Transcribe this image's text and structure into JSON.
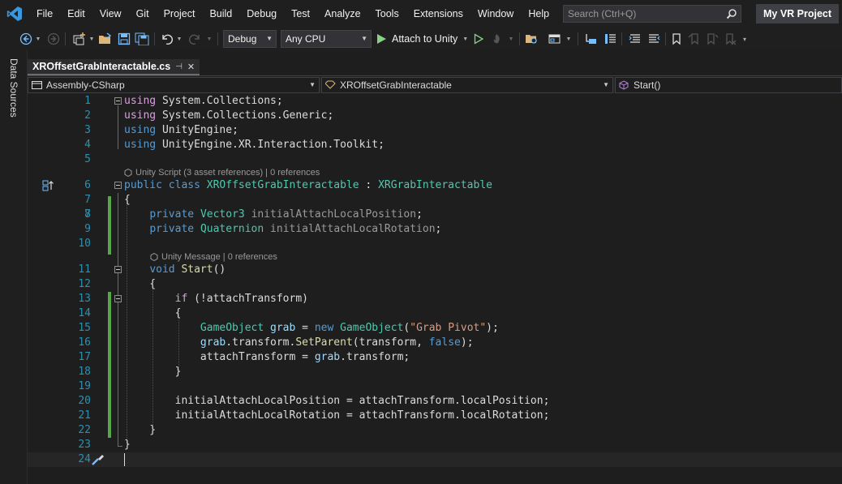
{
  "menubar": {
    "items": [
      "File",
      "Edit",
      "View",
      "Git",
      "Project",
      "Build",
      "Debug",
      "Test",
      "Analyze",
      "Tools",
      "Extensions",
      "Window",
      "Help"
    ],
    "search_placeholder": "Search (Ctrl+Q)",
    "project_name": "My VR Project"
  },
  "toolbar": {
    "config": "Debug",
    "platform": "Any CPU",
    "attach_label": "Attach to Unity"
  },
  "side_panel": {
    "label": "Data Sources"
  },
  "document_tab": {
    "title": "XROffsetGrabInteractable.cs",
    "pin": "⊣",
    "close": "✕"
  },
  "navbar": {
    "project": "Assembly-CSharp",
    "type": "XROffsetGrabInteractable",
    "member": "Start()"
  },
  "codelens": {
    "class": "Unity Script (3 asset references) | 0 references",
    "method": "Unity Message | 0 references"
  },
  "lines": {
    "n1": "1",
    "n2": "2",
    "n3": "3",
    "n4": "4",
    "n5": "5",
    "n6": "6",
    "n7": "7",
    "n8": "8",
    "n9": "9",
    "n10": "10",
    "n11": "11",
    "n12": "12",
    "n13": "13",
    "n14": "14",
    "n15": "15",
    "n16": "16",
    "n17": "17",
    "n18": "18",
    "n19": "19",
    "n20": "20",
    "n21": "21",
    "n22": "22",
    "n23": "23",
    "n24": "24"
  },
  "colors": {
    "keyword": "#569cd6",
    "control": "#d8a0df",
    "type": "#4ec9b0",
    "string": "#d69d85",
    "method": "#dcdcaa",
    "local": "#9cdcfe",
    "line_number": "#2b91af",
    "change_bar": "#57a64a"
  }
}
